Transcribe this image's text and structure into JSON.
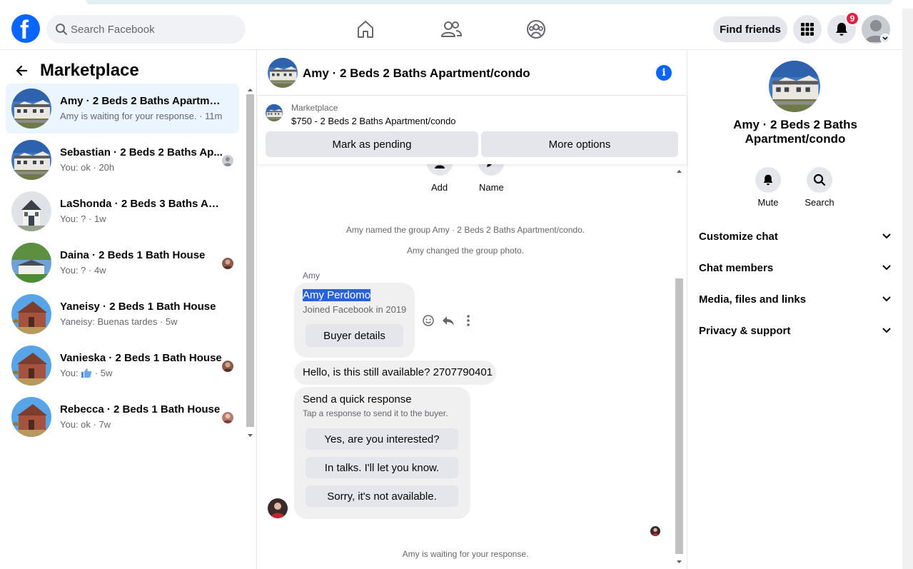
{
  "topbar": {
    "logo_letter": "f",
    "search_placeholder": "Search Facebook",
    "find_friends_label": "Find friends",
    "notification_count": "9"
  },
  "left": {
    "title": "Marketplace",
    "conversations": [
      {
        "name": "Amy · 2 Beds 2 Baths Apartmen...",
        "preview": "Amy is waiting for your response. · 11m"
      },
      {
        "name": "Sebastian · 2 Beds 2 Baths Ap...",
        "preview": "You: ok · 20h"
      },
      {
        "name": "LaShonda · 2 Beds 3 Baths Apar...",
        "preview": "You: ? · 1w"
      },
      {
        "name": "Daina · 2 Beds 1 Bath House",
        "preview": "You: ? · 4w"
      },
      {
        "name": "Yaneisy · 2 Beds 1 Bath House",
        "preview": "Yaneisy: Buenas tardes · 5w"
      },
      {
        "name": "Vanieska · 2 Beds 1 Bath House",
        "preview_prefix": "You:",
        "preview_suffix": "· 5w"
      },
      {
        "name": "Rebecca · 2 Beds 1 Bath House",
        "preview": "You: ok · 7w"
      }
    ]
  },
  "middle": {
    "header_title": "Amy · 2 Beds 2 Baths Apartment/condo",
    "listing_label": "Marketplace",
    "listing_text": "$750 - 2 Beds 2 Baths Apartment/condo",
    "mark_pending": "Mark as pending",
    "more_options": "More options",
    "add_label": "Add",
    "name_label": "Name",
    "sys1": "Amy named the group Amy · 2 Beds 2 Baths Apartment/condo.",
    "sys2": "Amy changed the group photo.",
    "sender": "Amy",
    "card_name": "Amy Perdomo",
    "card_joined": "Joined Facebook in 2019",
    "buyer_details": "Buyer details",
    "message": "Hello, is this still available? 2707790401",
    "quick_title": "Send a quick response",
    "quick_sub": "Tap a response to send it to the buyer.",
    "quick_options": [
      "Yes, are you interested?",
      "In talks. I'll let you know.",
      "Sorry, it's not available."
    ],
    "waiting": "Amy is waiting for your response."
  },
  "right": {
    "name": "Amy · 2 Beds 2 Baths Apartment/condo",
    "mute": "Mute",
    "search": "Search",
    "sections": [
      "Customize chat",
      "Chat members",
      "Media, files and links",
      "Privacy & support"
    ]
  },
  "colors": {
    "brand": "#0866ff",
    "active_row": "#ebf5ff",
    "badge": "#e41e3f",
    "selection": "#2962d4"
  }
}
